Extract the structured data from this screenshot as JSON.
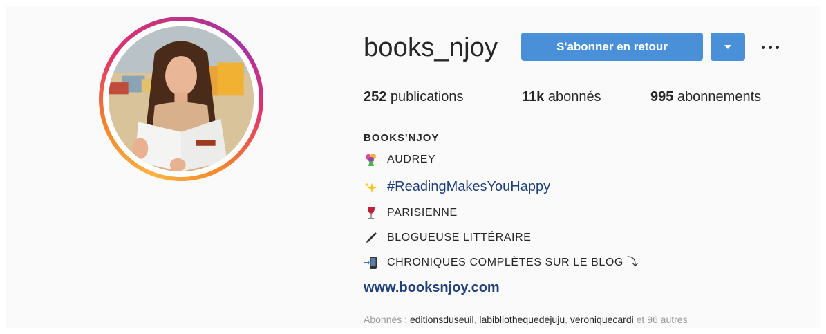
{
  "profile": {
    "username": "books_njoy",
    "follow_button_label": "S'abonner en retour",
    "stats": {
      "posts_count": "252",
      "posts_label": " publications",
      "followers_count": "11k",
      "followers_label": " abonnés",
      "following_count": "995",
      "following_label": " abonnements"
    },
    "display_name": "BOOKS'NJOY",
    "bio": [
      {
        "icon": "bouquet-icon",
        "text": "AUDREY"
      },
      {
        "icon": "sparkles-icon",
        "text": "#ReadingMakesYouHappy"
      },
      {
        "icon": "wine-glass-icon",
        "text": "PARISIENNE"
      },
      {
        "icon": "pen-icon",
        "text": "BLOGUEUSE LITTÉRAIRE"
      },
      {
        "icon": "mobile-arrow-icon",
        "text": "CHRONIQUES COMPLÈTES SUR LE BLOG ⤵"
      }
    ],
    "website": "www.booksnjoy.com",
    "followed_by": {
      "prefix": "Abonnés : ",
      "users": [
        "editionsduseuil",
        "labibliothequedejuju",
        "veroniquecardi"
      ],
      "sep": ", ",
      "suffix": " et 96 autres"
    }
  },
  "colors": {
    "accent": "#4a90d9",
    "link": "#1f3f7a",
    "text": "#262626",
    "muted": "#999999"
  }
}
